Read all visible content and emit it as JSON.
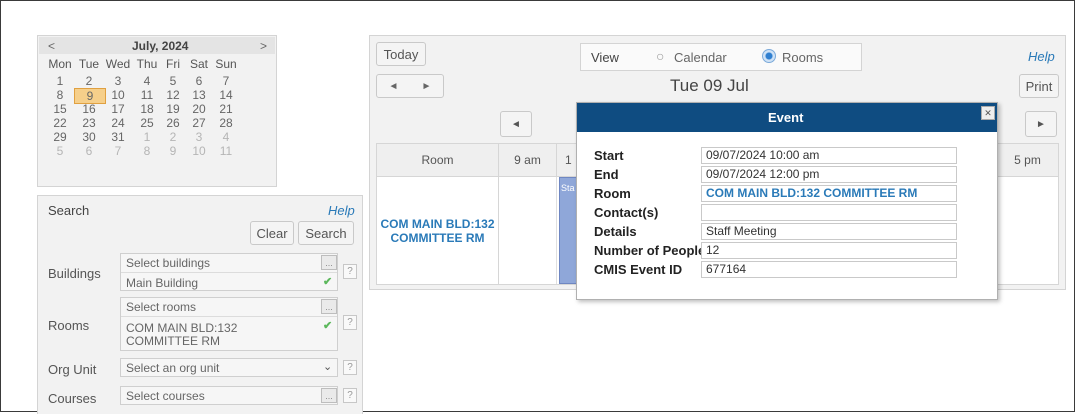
{
  "calendar": {
    "prev": "<",
    "month_title": "July, 2024",
    "next": ">",
    "weekdays": [
      "Mon",
      "Tue",
      "Wed",
      "Thu",
      "Fri",
      "Sat",
      "Sun"
    ],
    "weeks": [
      [
        "1",
        "2",
        "3",
        "4",
        "5",
        "6",
        "7"
      ],
      [
        "8",
        "9",
        "10",
        "11",
        "12",
        "13",
        "14"
      ],
      [
        "15",
        "16",
        "17",
        "18",
        "19",
        "20",
        "21"
      ],
      [
        "22",
        "23",
        "24",
        "25",
        "26",
        "27",
        "28"
      ],
      [
        "29",
        "30",
        "31",
        "1",
        "2",
        "3",
        "4"
      ],
      [
        "5",
        "6",
        "7",
        "8",
        "9",
        "10",
        "11"
      ]
    ],
    "selected_day": "9"
  },
  "search": {
    "title": "Search",
    "help": "Help",
    "clear": "Clear",
    "search_btn": "Search",
    "buildings_label": "Buildings",
    "buildings_placeholder": "Select buildings",
    "buildings_value": "Main Building",
    "rooms_label": "Rooms",
    "rooms_placeholder": "Select rooms",
    "rooms_value_1": "COM MAIN BLD:132",
    "rooms_value_2": "COMMITTEE RM",
    "org_label": "Org Unit",
    "org_placeholder": "Select an org unit",
    "courses_label": "Courses",
    "courses_placeholder": "Select courses",
    "ellipsis": "...",
    "question": "?"
  },
  "toolbar": {
    "today": "Today",
    "prev_arrow": "◄",
    "next_arrow": "►",
    "view_label": "View",
    "view_calendar": "Calendar",
    "view_rooms": "Rooms",
    "selected_view": "Rooms",
    "help": "Help",
    "date_title": "Tue 09 Jul",
    "print": "Print"
  },
  "grid": {
    "headers": [
      "Room",
      "9 am",
      "1",
      "5 pm"
    ],
    "room_line1": "COM MAIN BLD:132",
    "room_line2": "COMMITTEE RM",
    "event_snippet": "Sta"
  },
  "dialog": {
    "title": "Event",
    "close": "✕",
    "rows": [
      {
        "label": "Start",
        "value": "09/07/2024 10:00 am"
      },
      {
        "label": "End",
        "value": "09/07/2024 12:00 pm"
      },
      {
        "label": "Room",
        "value": "COM MAIN BLD:132 COMMITTEE RM"
      },
      {
        "label": "Contact(s)",
        "value": ""
      },
      {
        "label": "Details",
        "value": "Staff Meeting"
      },
      {
        "label": "Number of People",
        "value": "12"
      },
      {
        "label": "CMIS Event ID",
        "value": "677164"
      }
    ]
  },
  "colors": {
    "dialog_header": "#0f4c81",
    "link_blue": "#2a7ab8",
    "event_block": "#8fa7d9",
    "selected_day_bg": "#f6cf8a"
  }
}
